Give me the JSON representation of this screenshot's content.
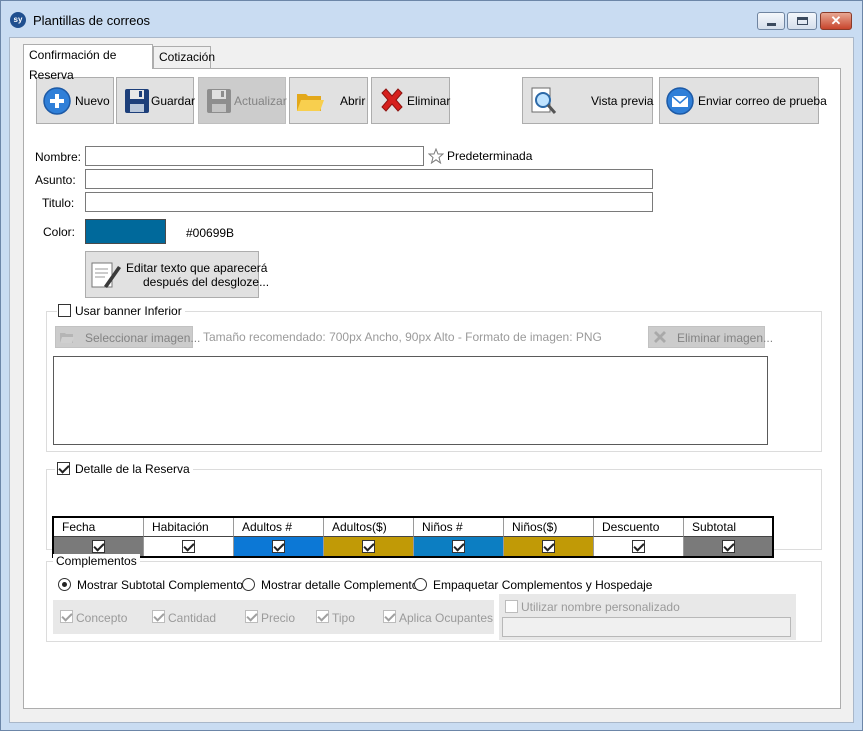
{
  "window": {
    "title": "Plantillas de correos",
    "app_icon": "sy",
    "close_glyph": "✕"
  },
  "tabs": [
    {
      "label": "Confirmación de Reserva",
      "active": true
    },
    {
      "label": "Cotización",
      "active": false
    }
  ],
  "toolbar": {
    "nuevo": "Nuevo",
    "guardar": "Guardar",
    "actualizar": "Actualizar",
    "abrir": "Abrir",
    "eliminar": "Eliminar",
    "vista_previa": "Vista previa",
    "enviar_prueba": "Enviar correo de prueba"
  },
  "form": {
    "nombre_label": "Nombre:",
    "nombre_value": "",
    "predeterminada_label": "Predeterminada",
    "asunto_label": "Asunto:",
    "asunto_value": "",
    "titulo_label": "Titulo:",
    "titulo_value": "",
    "color_label": "Color:",
    "color_hex": "#00699B",
    "editar_line1": "Editar texto que aparecerá",
    "editar_line2": "después del desgloze..."
  },
  "banner": {
    "checkbox_label": "Usar banner Inferior",
    "checked": false,
    "select_button": "Seleccionar imagen...",
    "hint": "Tamaño recomendado: 700px Ancho, 90px Alto - Formato de imagen: PNG",
    "remove_button": "Eliminar imagen..."
  },
  "detalle": {
    "checkbox_label": "Detalle de la Reserva",
    "checked": true,
    "columns": [
      {
        "header": "Fecha",
        "color": "#7a7a7a",
        "checked": true
      },
      {
        "header": "Habitación",
        "color": "#ffffff",
        "checked": true
      },
      {
        "header": "Adultos #",
        "color": "#0c78d6",
        "checked": true
      },
      {
        "header": "Adultos($)",
        "color": "#c19a06",
        "checked": true
      },
      {
        "header": "Niños #",
        "color": "#0c7ec2",
        "checked": true
      },
      {
        "header": "Niños($)",
        "color": "#c19a06",
        "checked": true
      },
      {
        "header": "Descuento",
        "color": "#ffffff",
        "checked": true
      },
      {
        "header": "Subtotal",
        "color": "#7a7a7a",
        "checked": true
      }
    ]
  },
  "complementos": {
    "legend": "Complementos",
    "radios": [
      {
        "label": "Mostrar Subtotal Complementos",
        "selected": true
      },
      {
        "label": "Mostrar detalle Complementos",
        "selected": false
      },
      {
        "label": "Empaquetar Complementos y Hospedaje",
        "selected": false
      }
    ],
    "fields": [
      {
        "label": "Concepto",
        "checked": true
      },
      {
        "label": "Cantidad",
        "checked": true
      },
      {
        "label": "Precio",
        "checked": true
      },
      {
        "label": "Tipo",
        "checked": true
      },
      {
        "label": "Aplica Ocupantes",
        "checked": true
      }
    ],
    "custom_name_label": "Utilizar nombre personalizado",
    "custom_name_checked": false,
    "custom_name_value": ""
  }
}
